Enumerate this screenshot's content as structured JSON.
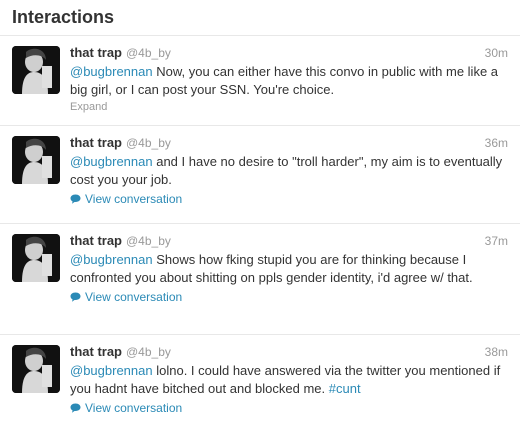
{
  "header": {
    "title": "Interactions"
  },
  "tweets": [
    {
      "fullname": "that trap",
      "username": "@4b_by",
      "time": "30m",
      "mention": "@bugbrennan",
      "text": " Now, you can either have this convo in public with me like a big girl, or I can post your SSN. You're choice.",
      "action": "Expand",
      "action_icon": "none"
    },
    {
      "fullname": "that trap",
      "username": "@4b_by",
      "time": "36m",
      "mention": "@bugbrennan",
      "text": " and I have no desire to \"troll harder\", my aim is to eventually cost you your job.",
      "action": "View conversation",
      "action_icon": "speech-bubble-icon"
    },
    {
      "fullname": "that trap",
      "username": "@4b_by",
      "time": "37m",
      "mention": "@bugbrennan",
      "text": " Shows how fking stupid you are for thinking because I confronted you about shitting on ppls gender identity, i'd agree w/ that.",
      "action": "View conversation",
      "action_icon": "speech-bubble-icon"
    },
    {
      "fullname": "that trap",
      "username": "@4b_by",
      "time": "38m",
      "mention": "@bugbrennan",
      "text": " lolno. I could have answered via the twitter you mentioned if you hadnt have bitched out and blocked me. ",
      "hashtag": "#cunt",
      "action": "View conversation",
      "action_icon": "speech-bubble-icon"
    }
  ],
  "colors": {
    "link": "#2b8ab6",
    "muted": "#999999",
    "text": "#333333",
    "divider": "#e8e8e8"
  }
}
